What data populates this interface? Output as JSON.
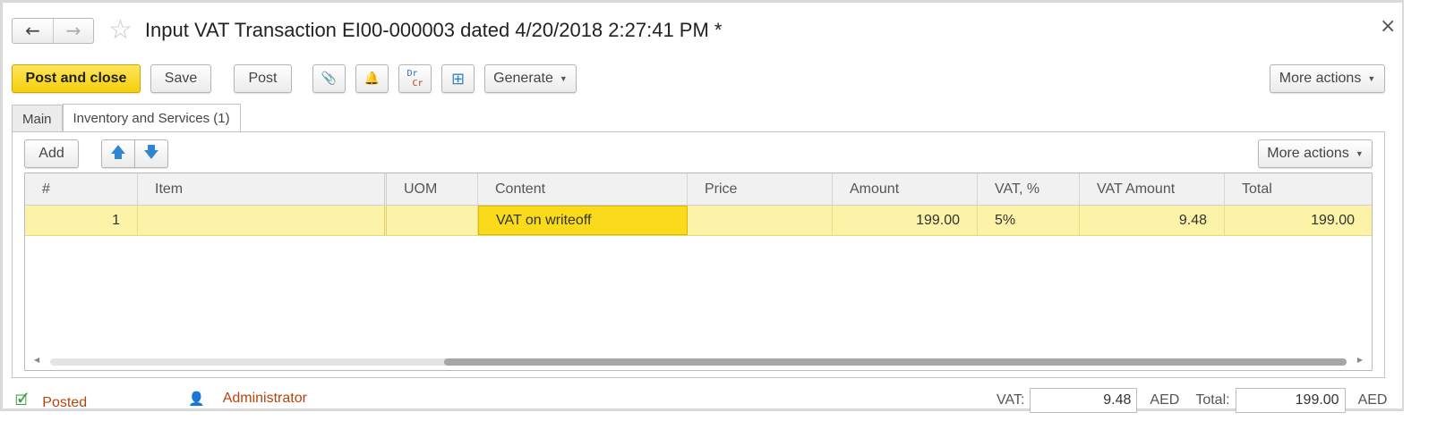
{
  "window": {
    "title": "Input VAT Transaction EI00-000003 dated 4/20/2018 2:27:41 PM *",
    "back_icon": "←",
    "forward_icon": "→",
    "star_icon": "☆",
    "close_icon": "×"
  },
  "toolbar": {
    "post_and_close": "Post and close",
    "save": "Save",
    "post": "Post",
    "attach_icon": "📎",
    "bell_icon": "🔔",
    "dr_label": "Dr",
    "cr_label": "Cr",
    "structure_icon": "⊞",
    "generate": "Generate",
    "more_actions": "More actions"
  },
  "tabs": [
    {
      "label": "Main"
    },
    {
      "label": "Inventory and Services (1)"
    }
  ],
  "table_toolbar": {
    "add": "Add",
    "up_icon": "🡅",
    "down_icon": "🡇",
    "more_actions": "More actions"
  },
  "table": {
    "columns": [
      "#",
      "Item",
      "UOM",
      "Content",
      "Price",
      "Amount",
      "VAT, %",
      "VAT Amount",
      "Total"
    ],
    "rows": [
      {
        "num": "1",
        "item": "",
        "uom": "",
        "content": "VAT on writeoff",
        "price": "",
        "amount": "199.00",
        "vat_pct": "5%",
        "vat_amount": "9.48",
        "total": "199.00"
      }
    ]
  },
  "footer": {
    "status": "Posted",
    "user": "Administrator",
    "vat_label": "VAT:",
    "vat_value": "9.48",
    "currency1": "AED",
    "total_label": "Total:",
    "total_value": "199.00",
    "currency2": "AED"
  },
  "colors": {
    "primary_button": "#f5cf0a",
    "row_highlight": "#fdf3a8",
    "selected_cell": "#fadb1c",
    "link": "#b5440c"
  }
}
